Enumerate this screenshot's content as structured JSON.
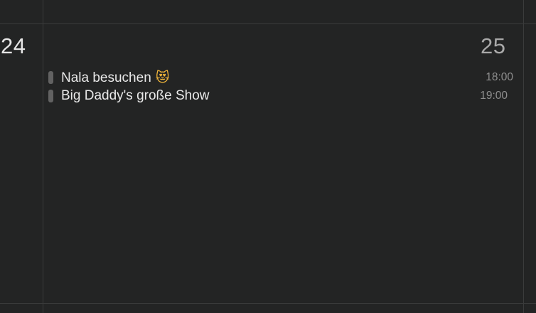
{
  "days": [
    {
      "number": "24",
      "muted": false
    },
    {
      "number": "25",
      "muted": true
    }
  ],
  "events": [
    {
      "title": "Nala besuchen",
      "emoji": "😻",
      "time": "18:00",
      "color": "#626262"
    },
    {
      "title": "Big Daddy's große Show",
      "emoji": "",
      "time": "19:00",
      "color": "#626262"
    }
  ]
}
